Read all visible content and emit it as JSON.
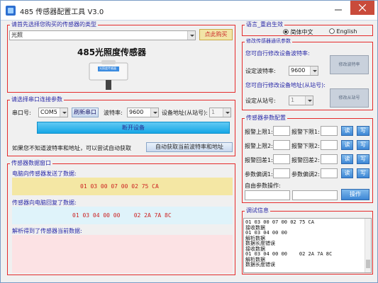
{
  "window": {
    "title": "485 传感器配置工具 V3.0"
  },
  "sensor_select": {
    "title": "请首先选择您购买的传感器的类型",
    "selected": "光照",
    "buy_label": "点此购买",
    "sensor_name": "485光照度传感器",
    "device_label": "光照度传感器"
  },
  "serial": {
    "title": "请选择串口连接参数",
    "port_label": "串口号:",
    "port_value": "COM5",
    "refresh_label": "刷新串口",
    "baud_label": "波特率:",
    "baud_value": "9600",
    "addr_label": "设备地址(从站号):",
    "addr_value": "1",
    "open_label": "断开设备",
    "hint": "如果您不知道波特率和地址，可以尝试自动获取",
    "auto_label": "自动获取当前波特率和地址"
  },
  "data_window": {
    "title": "传感器数据窗口",
    "sent_label": "电脑向传感器发送了数据:",
    "sent_hex": "01 03 00 07 00 02 75 CA",
    "reply_label": "传感器向电脑回复了数据:",
    "reply_hex": "01 03 04 00 00    02 2A 7A 8C",
    "parsed_label": "解析得到了传感器当前数据:"
  },
  "language": {
    "title": "语言_重启生效",
    "zh": "简体中文",
    "en": "English"
  },
  "modify": {
    "title": "修改传感器通讯参数",
    "baud_hint": "您可自行修改设备波特率:",
    "set_baud_label": "设定波特率:",
    "baud_value": "9600",
    "baud_btn": "修改波特率",
    "addr_hint": "您可自行修改设备地址(从站号):",
    "set_addr_label": "设定从站号:",
    "addr_value": "1",
    "addr_btn": "修改从站号"
  },
  "params": {
    "title": "传感器参数配置",
    "alarm_hi1": "报警上限1:",
    "alarm_lo1": "报警下限1:",
    "alarm_hi2": "报警上限2:",
    "alarm_lo2": "报警下限2:",
    "alarm_back1": "报警回差1:",
    "alarm_back2": "报警回差2:",
    "offset1": "参数偏调1:",
    "offset2": "参数偏调2:",
    "read": "读",
    "write": "写",
    "custom_label": "自由参数操作:",
    "operate": "操作"
  },
  "debug": {
    "title": "调试信息",
    "lines": [
      "01 03 00 07 00 02 75 CA",
      "接收数据",
      "01 03 04 00 00",
      "解析数据",
      "数据长度错误",
      "接收数据",
      "01 03 04 00 00    02 2A 7A 8C",
      "解析数据",
      "数据长度错误"
    ]
  },
  "colors": {
    "accent_red": "#e52b2b",
    "title_blue": "#2a2aa8",
    "sent_bg": "#f4e7a4",
    "reply_bg": "#dff3fa",
    "parsed_bg": "#fce2e4"
  }
}
